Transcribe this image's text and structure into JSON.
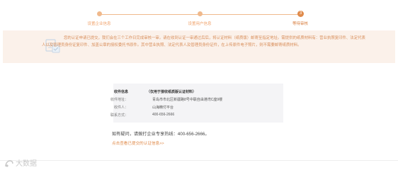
{
  "steps": [
    {
      "label": "设置企业信息",
      "state": "done"
    },
    {
      "label": "设置用户信息",
      "state": "done"
    },
    {
      "label": "等待审核",
      "state": "active",
      "number": "3"
    }
  ],
  "notice": {
    "text": "您的认证申请已提交，我们会在三个工作日完成审核一审。请在收到认证一审通过后后，将认证材料（纸质版）邮寄至指定地址。需提供的纸质材料有：营业执照复印件、法定代表人以及管理员身份证复印件、加盖公章的授权委托书原件。其中营业执照、法定代表人及管理员身份证件，在上传原件电子照片，则不需要邮寄纸质材料。"
  },
  "mail_info": {
    "heading_label": "收件信息",
    "heading_value": "（仅用于接收纸质版认证材料）",
    "rows": [
      {
        "label": "收件地址：",
        "value": "青岛市市北区新疆路8号中联自由港湾C座9楼"
      },
      {
        "label": "收件人：",
        "value": "山海精付平台"
      },
      {
        "label": "联系方式：",
        "value": "400-656-2666"
      }
    ]
  },
  "hotline": "如有疑问，请拨打企业专享热线：400-656-2666。",
  "view_link": "点击查看已提交的认证信息>>",
  "watermark": "大数据",
  "colors": {
    "accent": "#e08a4a",
    "banner_bg": "#fbf1ea",
    "info_bg": "#f4f4f6"
  }
}
